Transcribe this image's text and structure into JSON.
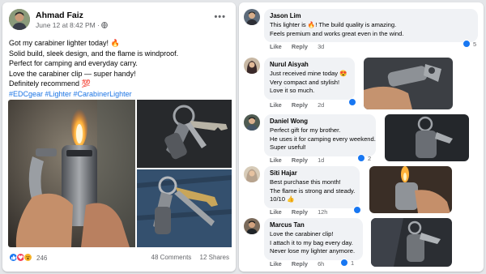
{
  "post": {
    "author": "Ahmad Faiz",
    "date": "June 12 at 8:42 PM",
    "separator": "·",
    "more_glyph": "•••",
    "lines": [
      "Got my carabiner lighter today! 🔥",
      "Solid build, sleek design, and the flame is windproof.",
      "Perfect for camping and everyday carry.",
      "Love the carabiner clip — super handy!",
      "Definitely recommend 💯"
    ],
    "hashtags": "#EDCgear #Lighter #CarabinerLighter",
    "images": [
      {
        "alt": "Lit carabiner lighter held in hand"
      },
      {
        "alt": "Carabiner lighter with keys"
      },
      {
        "alt": "Carabiner lighter on jeans belt loop"
      }
    ],
    "reaction_count": "246",
    "comments_count": "48 Comments",
    "shares_count": "12 Shares",
    "reaction_colors": {
      "like": "#1877f2",
      "love": "#f33e58",
      "wow": "#f7b125"
    }
  },
  "comments": [
    {
      "name": "Jason Lim",
      "lines": [
        "This lighter is 🔥! The build quality is amazing.",
        "Feels premium and works great even in the wind."
      ],
      "like_label": "Like",
      "reply_label": "Reply",
      "time": "3d",
      "reactions": "5"
    },
    {
      "name": "Nurul Aisyah",
      "lines": [
        "Just received mine today 😍",
        "Very compact and stylish!",
        "Love it so much."
      ],
      "like_label": "Like",
      "reply_label": "Reply",
      "time": "2d",
      "reactions": ""
    },
    {
      "name": "Daniel Wong",
      "lines": [
        "Perfect gift for my brother.",
        "He uses it for camping every weekend.",
        "Super useful!"
      ],
      "like_label": "Like",
      "reply_label": "Reply",
      "time": "1d",
      "reactions": "2"
    },
    {
      "name": "Siti Hajar",
      "lines": [
        "Best purchase this month!",
        "The flame is strong and steady.",
        "10/10 👍"
      ],
      "like_label": "Like",
      "reply_label": "Reply",
      "time": "12h",
      "reactions": ""
    },
    {
      "name": "Marcus Tan",
      "lines": [
        "Love the carabiner clip!",
        "I attach it to my bag every day.",
        "Never lose my lighter anymore."
      ],
      "like_label": "Like",
      "reply_label": "Reply",
      "time": "6h",
      "reactions": "1"
    }
  ]
}
